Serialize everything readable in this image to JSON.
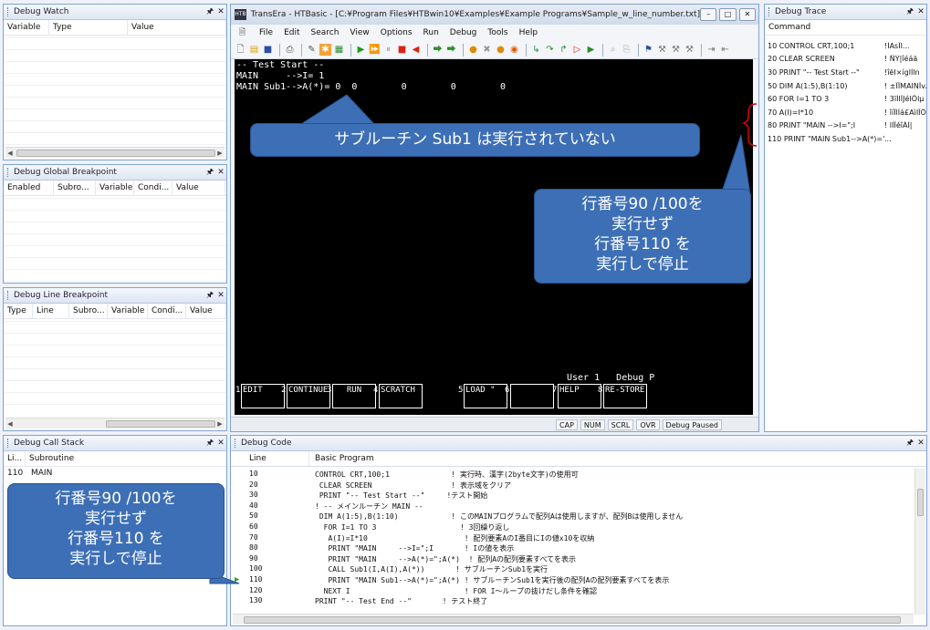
{
  "debug_watch": {
    "title": "Debug Watch",
    "columns": [
      "Variable",
      "Type",
      "Value"
    ]
  },
  "debug_global_breakpoint": {
    "title": "Debug Global Breakpoint",
    "columns": [
      "Enabled",
      "Subro...",
      "Variable",
      "Condi...",
      "Value"
    ]
  },
  "debug_line_breakpoint": {
    "title": "Debug Line Breakpoint",
    "columns": [
      "Type",
      "Line",
      "Subro...",
      "Variable",
      "Condi...",
      "Value"
    ]
  },
  "debug_call_stack": {
    "title": "Debug Call Stack",
    "columns": [
      "Li...",
      "Subroutine"
    ],
    "rows": [
      [
        "110",
        "MAIN"
      ]
    ]
  },
  "pane_pin": "q",
  "pane_close": "x",
  "app": {
    "title": "TransEra - HTBasic - [C:¥Program Files¥HTBwin10¥Examples¥Example Programs¥Sample_w_line_number.txt]",
    "menu": [
      "File",
      "Edit",
      "Search",
      "View",
      "Options",
      "Run",
      "Debug",
      "Tools",
      "Help"
    ],
    "screen_lines": [
      "-- Test Start --",
      "MAIN     -->I= 1",
      "MAIN Sub1-->A(*)= 0  0        0        0        0"
    ],
    "user_line": "User 1   Debug P",
    "softkeys": [
      {
        "num": "1",
        "label": "EDIT"
      },
      {
        "num": "2",
        "label": "CONTINUE"
      },
      {
        "num": "3",
        "label": "RUN"
      },
      {
        "num": "4",
        "label": "SCRATCH"
      },
      {
        "num": "5",
        "label": "LOAD \""
      },
      {
        "num": "6",
        "label": ""
      },
      {
        "num": "7",
        "label": "HELP"
      },
      {
        "num": "8",
        "label": "RE-STORE"
      }
    ],
    "status": [
      "CAP",
      "NUM",
      "SCRL",
      "OVR",
      "Debug Paused"
    ]
  },
  "debug_trace": {
    "title": "Debug Trace",
    "column": "Command",
    "rows": [
      [
        "10 CONTROL CRT,100;1",
        "!ÌAsÎI..."
      ],
      [
        "20 CLEAR SCREEN",
        "! ÑÝ|îéáä"
      ],
      [
        "30 PRINT \"-- Test Start --\"",
        "!îëI×íglÍln"
      ],
      [
        "50 DIM A(1:5),B(1:10)",
        "! ±ÎÏMAINÎv..."
      ],
      [
        "60 FOR I=1 TO 3",
        "! 3ïÌIÎJéIÕlµ"
      ],
      [
        "70 A(I)=I*10",
        "! îíÏlÌá£AìIÏÕ..."
      ],
      [
        "80 PRINT \"MAIN    -->I=\";I",
        "! IÍÏéîÁÌ|"
      ],
      [
        "110 PRINT \"MAIN Sub1-->A(*)=\";A(*)",
        "..."
      ]
    ]
  },
  "debug_code": {
    "title": "Debug Code",
    "columns": [
      "Line",
      "Basic Program"
    ],
    "rows": [
      [
        "10",
        "CONTROL CRT,100;1              ! 実行時、漢字(2byte文字)の使用可"
      ],
      [
        "20",
        " CLEAR SCREEN                  ! 表示域をクリア"
      ],
      [
        "30",
        " PRINT \"-- Test Start --\"     !テスト開始"
      ],
      [
        "40",
        "! -- メインルーチン MAIN --"
      ],
      [
        "50",
        " DIM A(1:5),B(1:10)            ! このMAINプログラムで配列Aは使用しますが、配列Bは使用しません"
      ],
      [
        "60",
        "  FOR I=1 TO 3                   ! 3回繰り返し"
      ],
      [
        "70",
        "   A(I)=I*10                      ! 配列要素AのI番目にIの値x10を収納"
      ],
      [
        "80",
        "   PRINT \"MAIN     -->I=\";I       ! Iの値を表示"
      ],
      [
        "90",
        "   PRINT \"MAIN     -->A(*)=\";A(*)  ! 配列Aの配列要素すべてを表示"
      ],
      [
        "100",
        "   CALL Sub1(I,A(I),A(*))       ! サブルーチンSub1を実行"
      ],
      [
        "110",
        "   PRINT \"MAIN Sub1-->A(*)=\";A(*) ! サブルーチンSub1を実行後の配列Aの配列要素すべてを表示"
      ],
      [
        "120",
        "  NEXT I                          ! FOR I〜ループの抜けだし条件を確認"
      ],
      [
        "130",
        "PRINT \"-- Test End --\"       ! テスト終了"
      ]
    ],
    "current_line": "110"
  },
  "callouts": {
    "sub1": "サブルーチン Sub1 は実行されていない",
    "lines": [
      "行番号90 /100を",
      "実行せず",
      "行番号110 を",
      "実行しで停止"
    ]
  },
  "colors": {
    "accent": "#3d6fb6",
    "pane_border": "#7fa3d4",
    "breakpoint_arrow": "#2fa52f"
  }
}
